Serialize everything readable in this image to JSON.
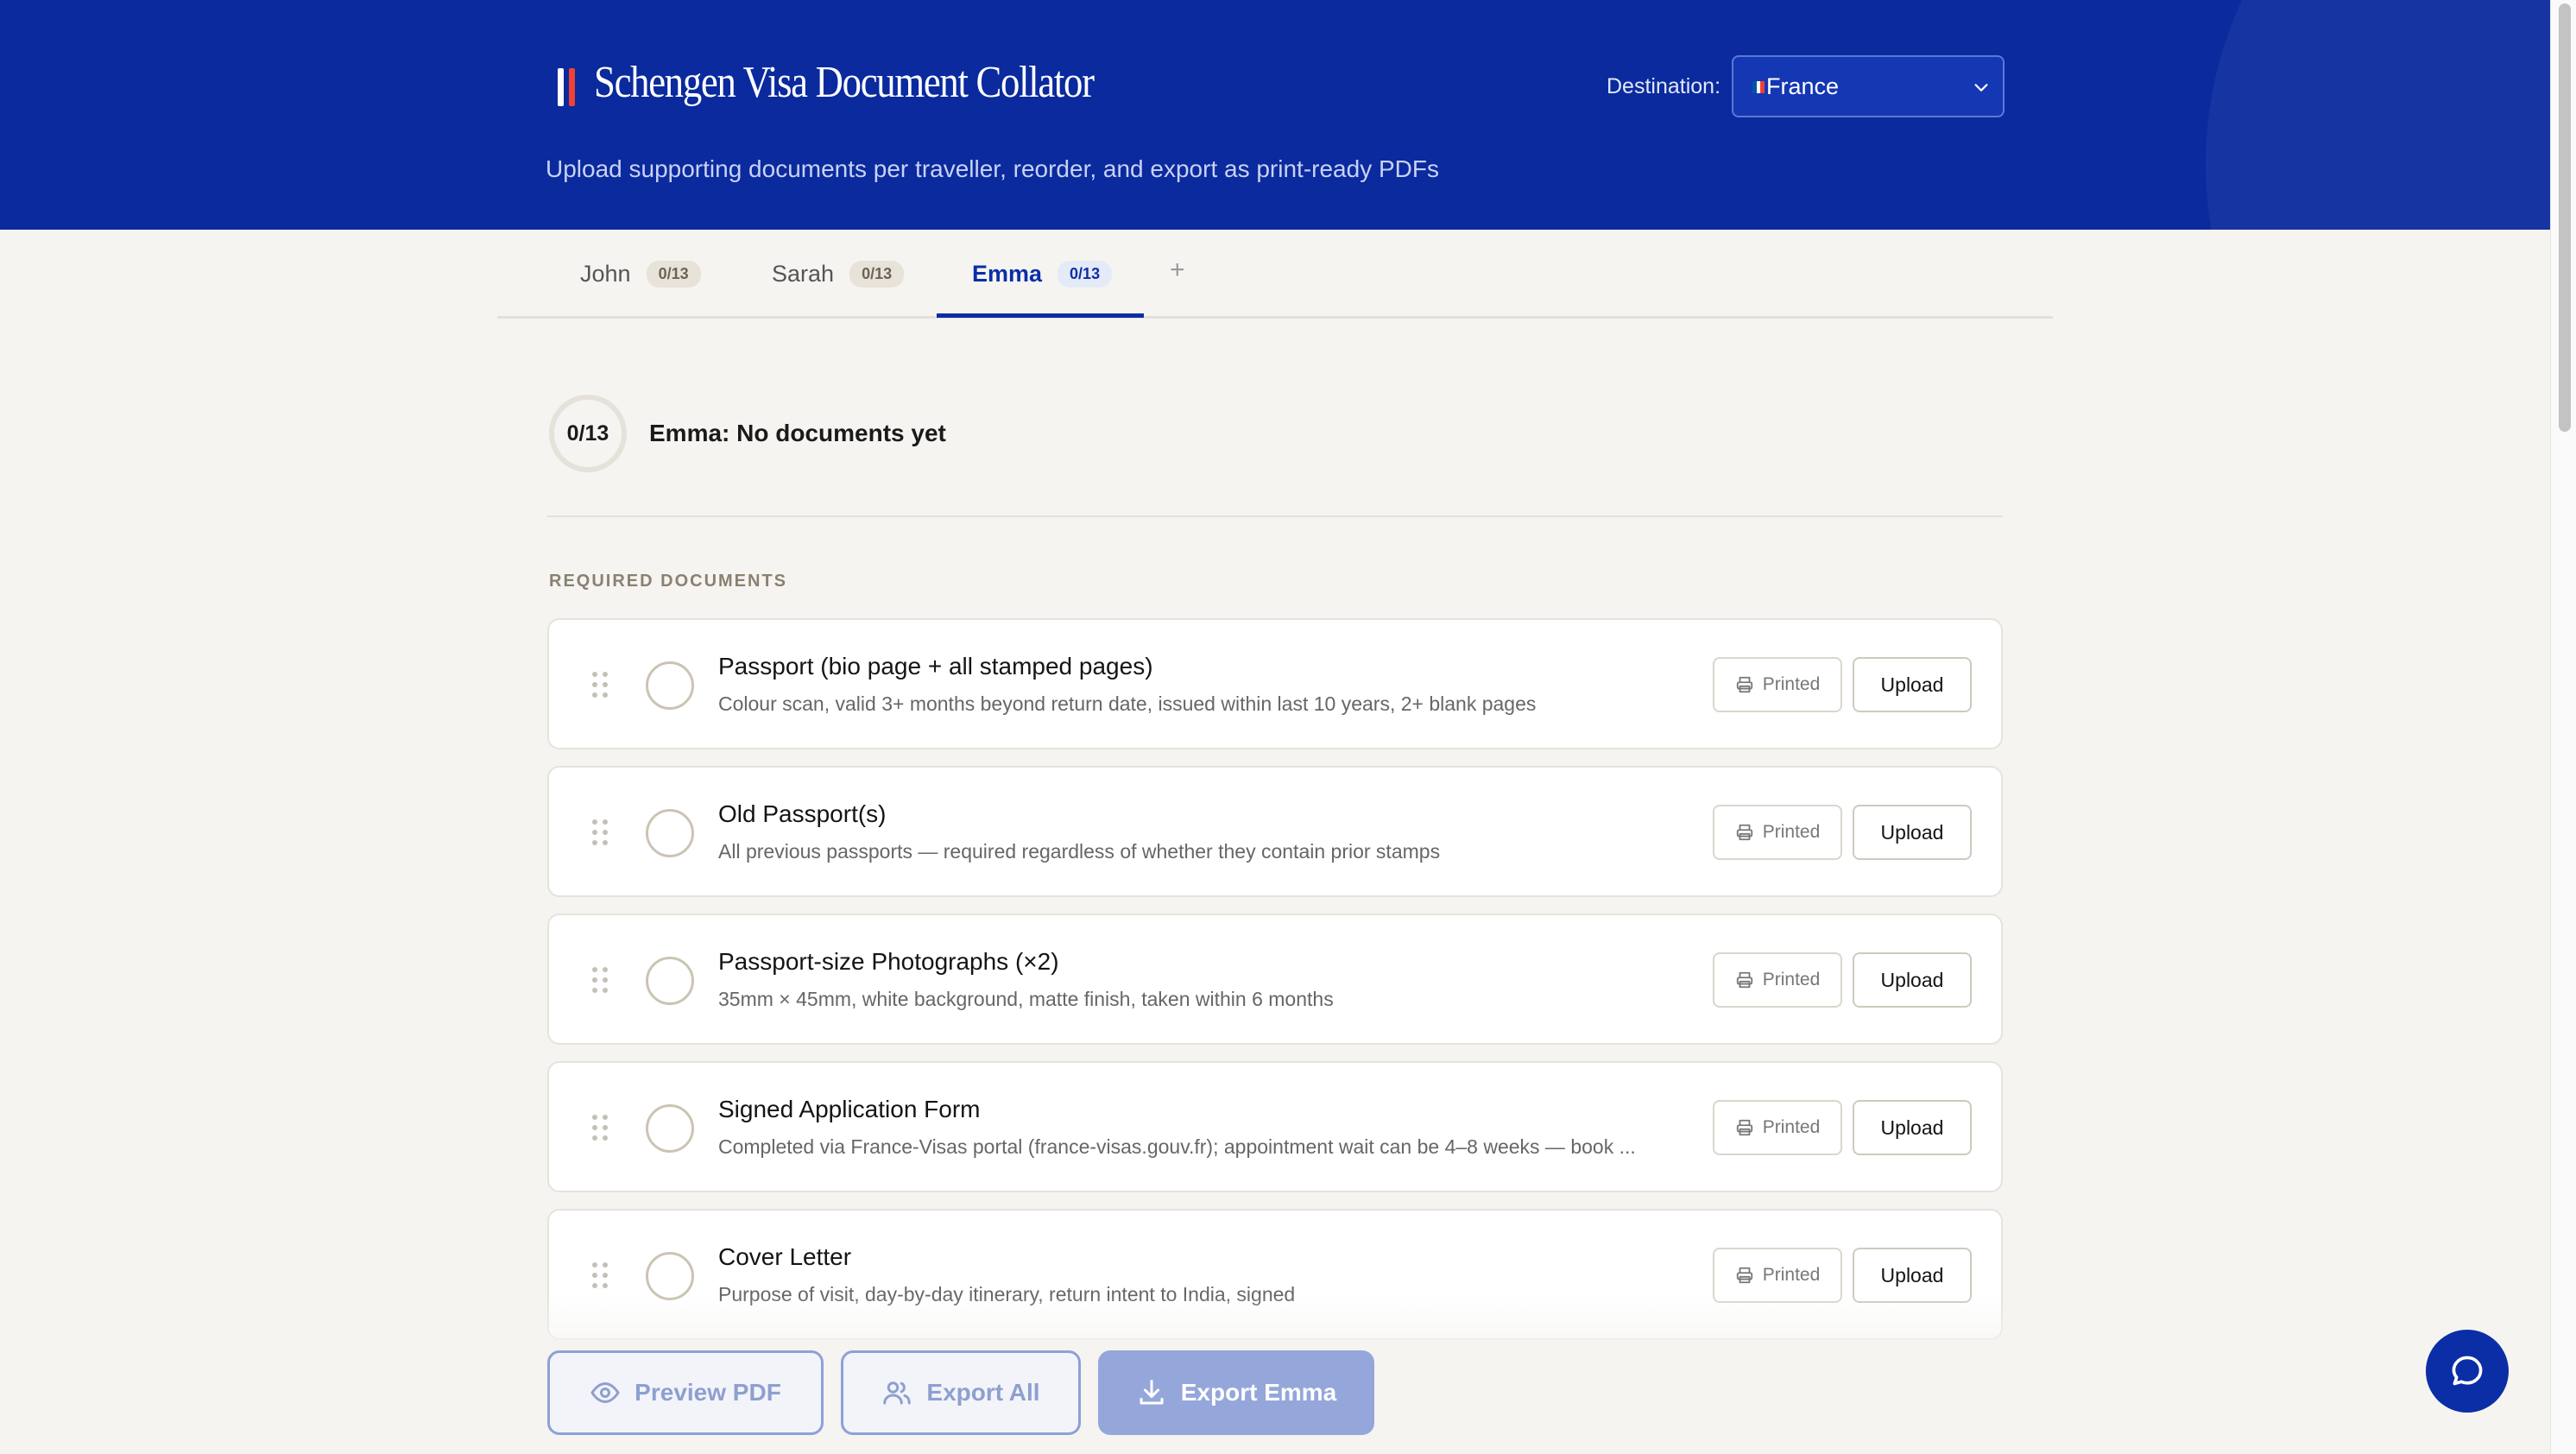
{
  "header": {
    "title": "Schengen Visa Document Collator",
    "subtitle": "Upload supporting documents per traveller, reorder, and export as print-ready PDFs",
    "destination_label": "Destination:",
    "destination_value": "France",
    "colors": {
      "brand": "#0a2a9e",
      "flag_blue": "#0055a4",
      "flag_red": "#ef4135"
    }
  },
  "tabs": [
    {
      "label": "John",
      "count": "0/13"
    },
    {
      "label": "Sarah",
      "count": "0/13"
    },
    {
      "label": "Emma",
      "count": "0/13",
      "active": true
    }
  ],
  "add_tab_label": "+",
  "summary": {
    "progress": "0/13",
    "text": "Emma: No documents yet"
  },
  "section_label": "REQUIRED DOCUMENTS",
  "documents": [
    {
      "title": "Passport (bio page + all stamped pages)",
      "desc": "Colour scan, valid 3+ months beyond return date, issued within last 10 years, 2+ blank pages",
      "printed_label": "Printed",
      "upload_label": "Upload"
    },
    {
      "title": "Old Passport(s)",
      "desc": "All previous passports — required regardless of whether they contain prior stamps",
      "printed_label": "Printed",
      "upload_label": "Upload"
    },
    {
      "title": "Passport-size Photographs (×2)",
      "desc": "35mm × 45mm, white background, matte finish, taken within 6 months",
      "printed_label": "Printed",
      "upload_label": "Upload"
    },
    {
      "title": "Signed Application Form",
      "desc": "Completed via France-Visas portal (france-visas.gouv.fr); appointment wait can be 4–8 weeks — book ...",
      "printed_label": "Printed",
      "upload_label": "Upload"
    },
    {
      "title": "Cover Letter",
      "desc": "Purpose of visit, day-by-day itinerary, return intent to India, signed",
      "printed_label": "Printed",
      "upload_label": "Upload"
    }
  ],
  "actions": {
    "preview": "Preview PDF",
    "export_all": "Export All",
    "export_one": "Export Emma"
  }
}
